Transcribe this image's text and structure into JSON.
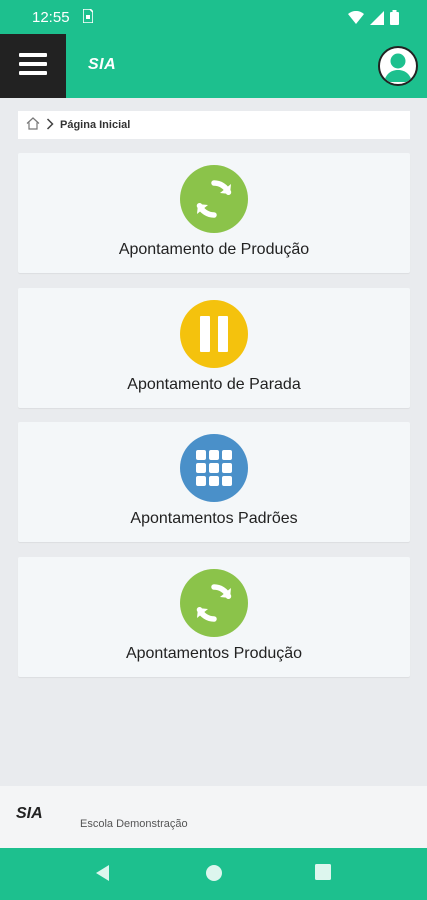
{
  "status_bar": {
    "time": "12:55",
    "sim_icon": "sim-card-icon",
    "icons": [
      "wifi-icon",
      "signal-icon",
      "battery-icon"
    ]
  },
  "app_bar": {
    "logo_text": "SIA",
    "menu_icon": "hamburger-icon",
    "profile_icon": "user-avatar-icon"
  },
  "breadcrumb": {
    "home_icon": "home-icon",
    "separator_icon": "chevron-right-icon",
    "label": "Página Inicial"
  },
  "cards": [
    {
      "label": "Apontamento de Produção",
      "icon": "refresh-icon",
      "color": "#8bc34a"
    },
    {
      "label": "Apontamento de Parada",
      "icon": "pause-icon",
      "color": "#f4c20d"
    },
    {
      "label": "Apontamentos Padrões",
      "icon": "grid-icon",
      "color": "#4a90c9"
    },
    {
      "label": "Apontamentos Produção",
      "icon": "refresh-icon",
      "color": "#8bc34a"
    }
  ],
  "footer": {
    "logo_text": "SIA",
    "school": "Escola Demonstração"
  },
  "nav_bar": {
    "icons": [
      "back-icon",
      "home-circle-icon",
      "recents-icon"
    ]
  },
  "colors": {
    "primary": "#1dc08e",
    "menu_bg": "#222222",
    "background": "#e9ebee"
  }
}
